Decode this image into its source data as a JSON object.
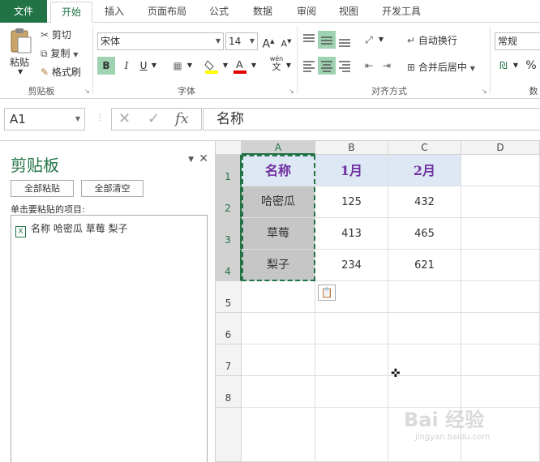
{
  "tabs": [
    {
      "label": "文件"
    },
    {
      "label": "开始"
    },
    {
      "label": "插入"
    },
    {
      "label": "页面布局"
    },
    {
      "label": "公式"
    },
    {
      "label": "数据"
    },
    {
      "label": "审阅"
    },
    {
      "label": "视图"
    },
    {
      "label": "开发工具"
    }
  ],
  "ribbon": {
    "clipboard": {
      "paste": "粘贴",
      "cut": "剪切",
      "copy": "复制",
      "format_painter": "格式刷",
      "group": "剪贴板"
    },
    "font": {
      "name": "宋体",
      "size": "14",
      "bold": "B",
      "italic": "I",
      "underline": "U",
      "group": "字体",
      "grow": "A",
      "shrink": "A",
      "phonetic": "wén"
    },
    "alignment": {
      "wrap": "自动换行",
      "merge": "合并后居中",
      "group": "对齐方式"
    },
    "number": {
      "format": "常规",
      "percent": "%",
      "group": "数"
    }
  },
  "formula_bar": {
    "name_box": "A1",
    "fx": "fx",
    "content": "名称"
  },
  "clipboard_pane": {
    "title": "剪贴板",
    "paste_all": "全部粘贴",
    "clear_all": "全部清空",
    "hint": "单击要粘贴的项目:",
    "item": "名称 哈密瓜 草莓 梨子",
    "item_icon": "excel-icon"
  },
  "sheet": {
    "columns": [
      "A",
      "B",
      "C",
      "D"
    ],
    "rows": [
      "1",
      "2",
      "3",
      "4",
      "5",
      "6",
      "7",
      "8"
    ],
    "header": [
      "名称",
      "1月",
      "2月"
    ],
    "data": [
      [
        "哈密瓜",
        "125",
        "432"
      ],
      [
        "草莓",
        "413",
        "465"
      ],
      [
        "梨子",
        "234",
        "621"
      ]
    ],
    "accent": "#217346",
    "header_text_color": "#7030a0"
  },
  "watermark": {
    "main": "Bai 经验",
    "sub": "jingyan.baidu.com"
  }
}
